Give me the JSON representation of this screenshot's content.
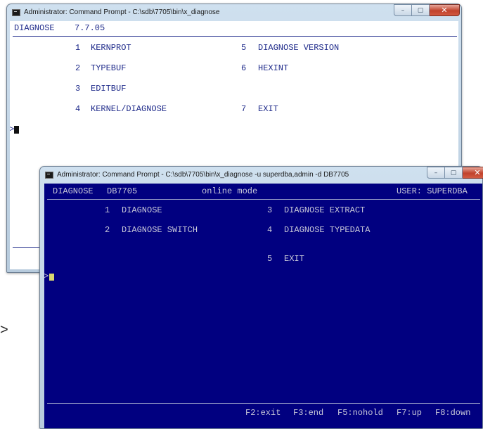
{
  "back_window": {
    "title": "Administrator: Command Prompt - C:\\sdb\\7705\\bin\\x_diagnose",
    "controls": {
      "minimize": "–",
      "maximize": "▢",
      "close": "✕"
    },
    "header": {
      "app": "DIAGNOSE",
      "version": "7.7.05"
    },
    "menu": [
      {
        "num": "1",
        "label": "KERNPROT"
      },
      {
        "num": "2",
        "label": "TYPEBUF"
      },
      {
        "num": "3",
        "label": "EDITBUF"
      },
      {
        "num": "4",
        "label": "KERNEL/DIAGNOSE"
      },
      {
        "num": "5",
        "label": "DIAGNOSE VERSION"
      },
      {
        "num": "6",
        "label": "HEXINT"
      },
      {
        "num": "7",
        "label": "EXIT"
      }
    ],
    "prompt": ">"
  },
  "front_window": {
    "title": "Administrator: Command Prompt - C:\\sdb\\7705\\bin\\x_diagnose  -u superdba,admin -d DB7705",
    "controls": {
      "minimize": "–",
      "maximize": "▢",
      "close": "✕"
    },
    "header": {
      "app": "DIAGNOSE",
      "db": "DB7705",
      "mode": "online mode",
      "user": "USER: SUPERDBA"
    },
    "menu": [
      {
        "num": "1",
        "label": "DIAGNOSE"
      },
      {
        "num": "2",
        "label": "DIAGNOSE SWITCH"
      },
      {
        "num": "3",
        "label": "DIAGNOSE EXTRACT"
      },
      {
        "num": "4",
        "label": "DIAGNOSE TYPEDATA"
      },
      {
        "num": "5",
        "label": "EXIT"
      }
    ],
    "prompt": ">",
    "function_keys": [
      "F2:exit",
      "F3:end",
      "F5:nohold",
      "F7:up",
      "F8:down"
    ]
  },
  "outside_prompt": ">"
}
